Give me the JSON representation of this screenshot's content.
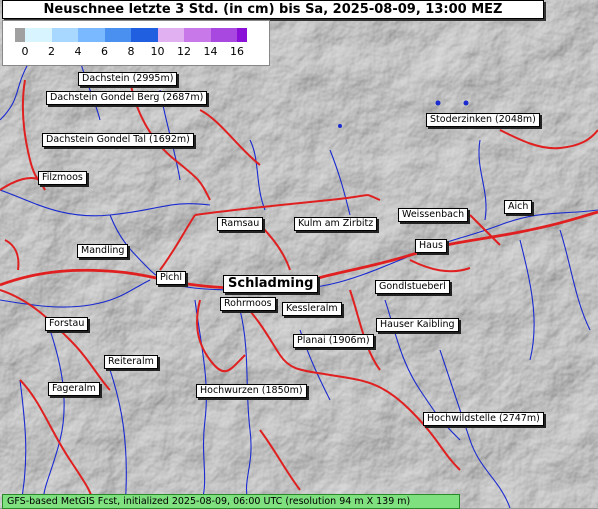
{
  "title": "Neuschnee letzte 3 Std. (in cm) bis Sa, 2025-08-09, 13:00 MEZ",
  "legend": {
    "ticks": [
      "0",
      "2",
      "4",
      "6",
      "8",
      "10",
      "12",
      "14",
      "16"
    ],
    "colors": [
      "#a0a0a0",
      "#d8f4ff",
      "#a8d8ff",
      "#7ab8ff",
      "#4a90f0",
      "#2060e0",
      "#e0b0f0",
      "#c878e8",
      "#a848e0",
      "#8a10d8"
    ]
  },
  "places": [
    {
      "name": "Dachstein (2995m)"
    },
    {
      "name": "Dachstein Gondel Berg (2687m)"
    },
    {
      "name": "Dachstein Gondel Tal (1692m)"
    },
    {
      "name": "Filzmoos"
    },
    {
      "name": "Stoderzinken (2048m)"
    },
    {
      "name": "Ramsau"
    },
    {
      "name": "Kulm am Zirbitz"
    },
    {
      "name": "Weissenbach"
    },
    {
      "name": "Aich"
    },
    {
      "name": "Mandling"
    },
    {
      "name": "Haus"
    },
    {
      "name": "Pichl"
    },
    {
      "name": "Schladming"
    },
    {
      "name": "Gondlstueberl"
    },
    {
      "name": "Rohrmoos"
    },
    {
      "name": "Kessleralm"
    },
    {
      "name": "Forstau"
    },
    {
      "name": "Hauser Kaibling"
    },
    {
      "name": "Planai (1906m)"
    },
    {
      "name": "Reiteralm"
    },
    {
      "name": "Fageralm"
    },
    {
      "name": "Hochwurzen (1850m)"
    },
    {
      "name": "Hochwildstelle (2747m)"
    }
  ],
  "footer": "GFS-based MetGIS Fcst, initialized 2025-08-09, 06:00 UTC  (resolution 94 m X 139 m)"
}
